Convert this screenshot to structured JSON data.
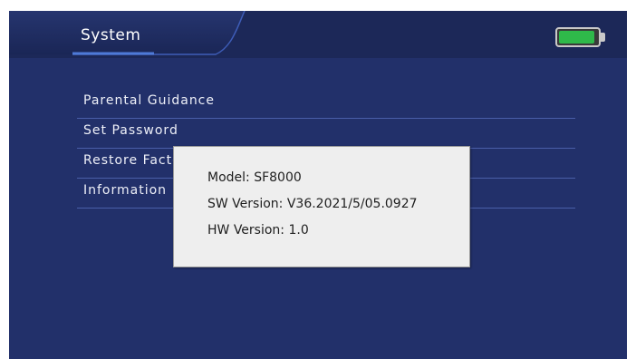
{
  "header": {
    "title": "System",
    "battery": {
      "icon": "battery-icon",
      "level": 0.92,
      "fill_color": "#2fb94a"
    }
  },
  "menu": {
    "items": [
      {
        "label": "Parental Guidance"
      },
      {
        "label": "Set Password"
      },
      {
        "label": "Restore Factory Default"
      },
      {
        "label": "Information"
      }
    ]
  },
  "info_dialog": {
    "model": "Model: SF8000",
    "sw_version": "SW Version: V36.2021/5/05.0927",
    "hw_version": "HW Version: 1.0"
  },
  "colors": {
    "background": "#22306a",
    "header": "#1c2858",
    "dialog": "#eeeeee"
  }
}
